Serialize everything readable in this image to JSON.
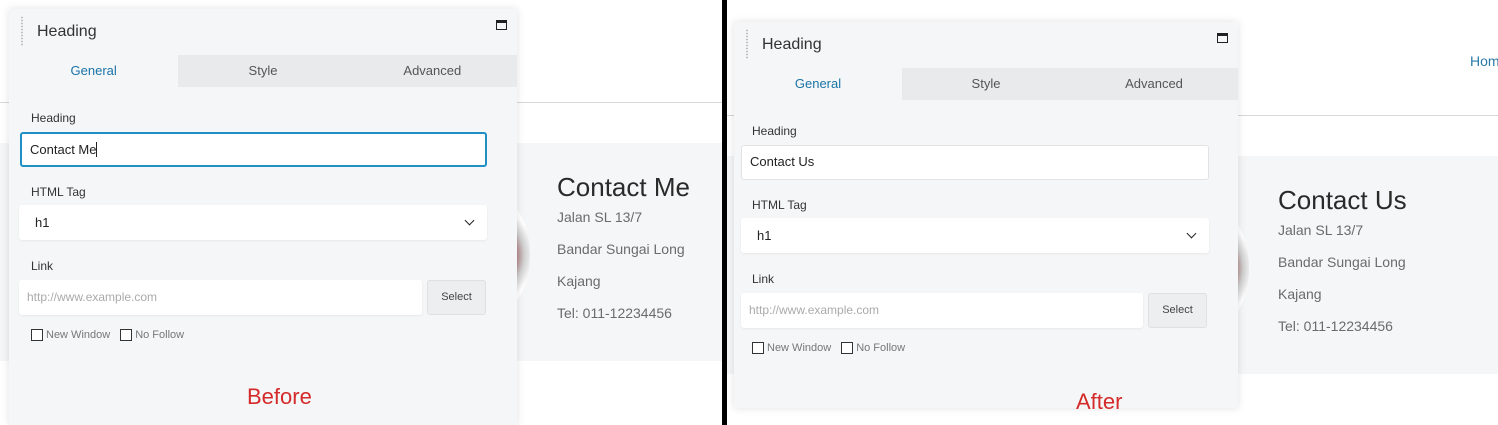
{
  "before": {
    "panel": {
      "title": "Heading",
      "tabs": [
        "General",
        "Style",
        "Advanced"
      ],
      "heading_label": "Heading",
      "heading_value": "Contact Me",
      "html_tag_label": "HTML Tag",
      "html_tag_value": "h1",
      "link_label": "Link",
      "link_placeholder": "http://www.example.com",
      "select_label": "Select",
      "new_window_label": "New Window",
      "no_follow_label": "No Follow"
    },
    "contact": {
      "title": "Contact Me",
      "lines": [
        "Jalan SL 13/7",
        "Bandar Sungai Long",
        "Kajang",
        "Tel: 011-12234456"
      ]
    },
    "caption": "Before"
  },
  "after": {
    "panel": {
      "title": "Heading",
      "tabs": [
        "General",
        "Style",
        "Advanced"
      ],
      "heading_label": "Heading",
      "heading_value": "Contact Us",
      "html_tag_label": "HTML Tag",
      "html_tag_value": "h1",
      "link_label": "Link",
      "link_placeholder": "http://www.example.com",
      "select_label": "Select",
      "new_window_label": "New Window",
      "no_follow_label": "No Follow"
    },
    "contact": {
      "title": "Contact Us",
      "lines": [
        "Jalan SL 13/7",
        "Bandar Sungai Long",
        "Kajang",
        "Tel: 011-12234456"
      ]
    },
    "nav_home": "Hom",
    "caption": "After"
  },
  "colors": {
    "accent": "#1f8fc4",
    "caption_red": "#d42a2a",
    "panel_bg": "#f5f6f7"
  }
}
